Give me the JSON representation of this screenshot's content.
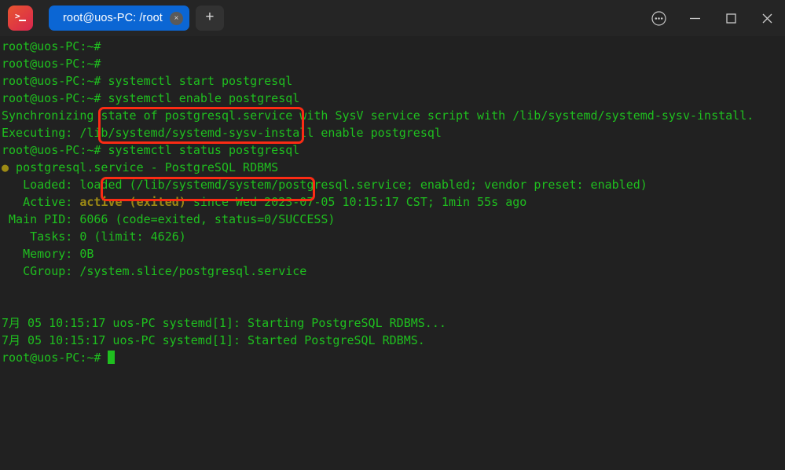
{
  "window": {
    "app_icon": "terminal-icon",
    "tabs": [
      {
        "label": "root@uos-PC: /root",
        "close": "×"
      }
    ],
    "new_tab_label": "+",
    "controls": {
      "menu": "more-options-icon",
      "minimize": "minimize-icon",
      "maximize": "maximize-icon",
      "close": "close-icon"
    }
  },
  "terminal": {
    "prompt": "root@uos-PC:~#",
    "lines": [
      {
        "type": "prompt",
        "prompt": "root@uos-PC:~#",
        "command": ""
      },
      {
        "type": "prompt",
        "prompt": "root@uos-PC:~#",
        "command": ""
      },
      {
        "type": "prompt",
        "prompt": "root@uos-PC:~#",
        "command": " systemctl start postgresql"
      },
      {
        "type": "prompt",
        "prompt": "root@uos-PC:~#",
        "command": " systemctl enable postgresql"
      },
      {
        "type": "out",
        "text": "Synchronizing state of postgresql.service with SysV service script with /lib/systemd/systemd-sysv-install."
      },
      {
        "type": "out",
        "text": "Executing: /lib/systemd/systemd-sysv-install enable postgresql"
      },
      {
        "type": "prompt",
        "prompt": "root@uos-PC:~#",
        "command": " systemctl status postgresql"
      }
    ],
    "status": {
      "bullet": "●",
      "header": " postgresql.service - PostgreSQL RDBMS",
      "loaded_label": "   Loaded: ",
      "loaded_value": "loaded (/lib/systemd/system/postgresql.service; enabled; vendor preset: enabled)",
      "active_label": "   Active: ",
      "active_state": "active (exited)",
      "active_rest": " since Wed 2023-07-05 10:15:17 CST; 1min 55s ago",
      "main_pid": " Main PID: 6066 (code=exited, status=0/SUCCESS)",
      "tasks": "    Tasks: 0 (limit: 4626)",
      "memory": "   Memory: 0B",
      "cgroup": "   CGroup: /system.slice/postgresql.service",
      "blank": ""
    },
    "logs": [
      "7月 05 10:15:17 uos-PC systemd[1]: Starting PostgreSQL RDBMS...",
      "7月 05 10:15:17 uos-PC systemd[1]: Started PostgreSQL RDBMS."
    ],
    "final_prompt": "root@uos-PC:~# "
  },
  "annotations": {
    "box_color": "#fb2b14",
    "boxes": [
      {
        "name": "highlight-start-enable-commands"
      },
      {
        "name": "highlight-status-command"
      }
    ]
  },
  "colors": {
    "terminal_bg": "#212121",
    "titlebar_bg": "#252525",
    "tab_active": "#0b66d4",
    "text_green": "#1fbf1f",
    "text_olive": "#9c8a14",
    "annotation_red": "#fb2b14"
  }
}
